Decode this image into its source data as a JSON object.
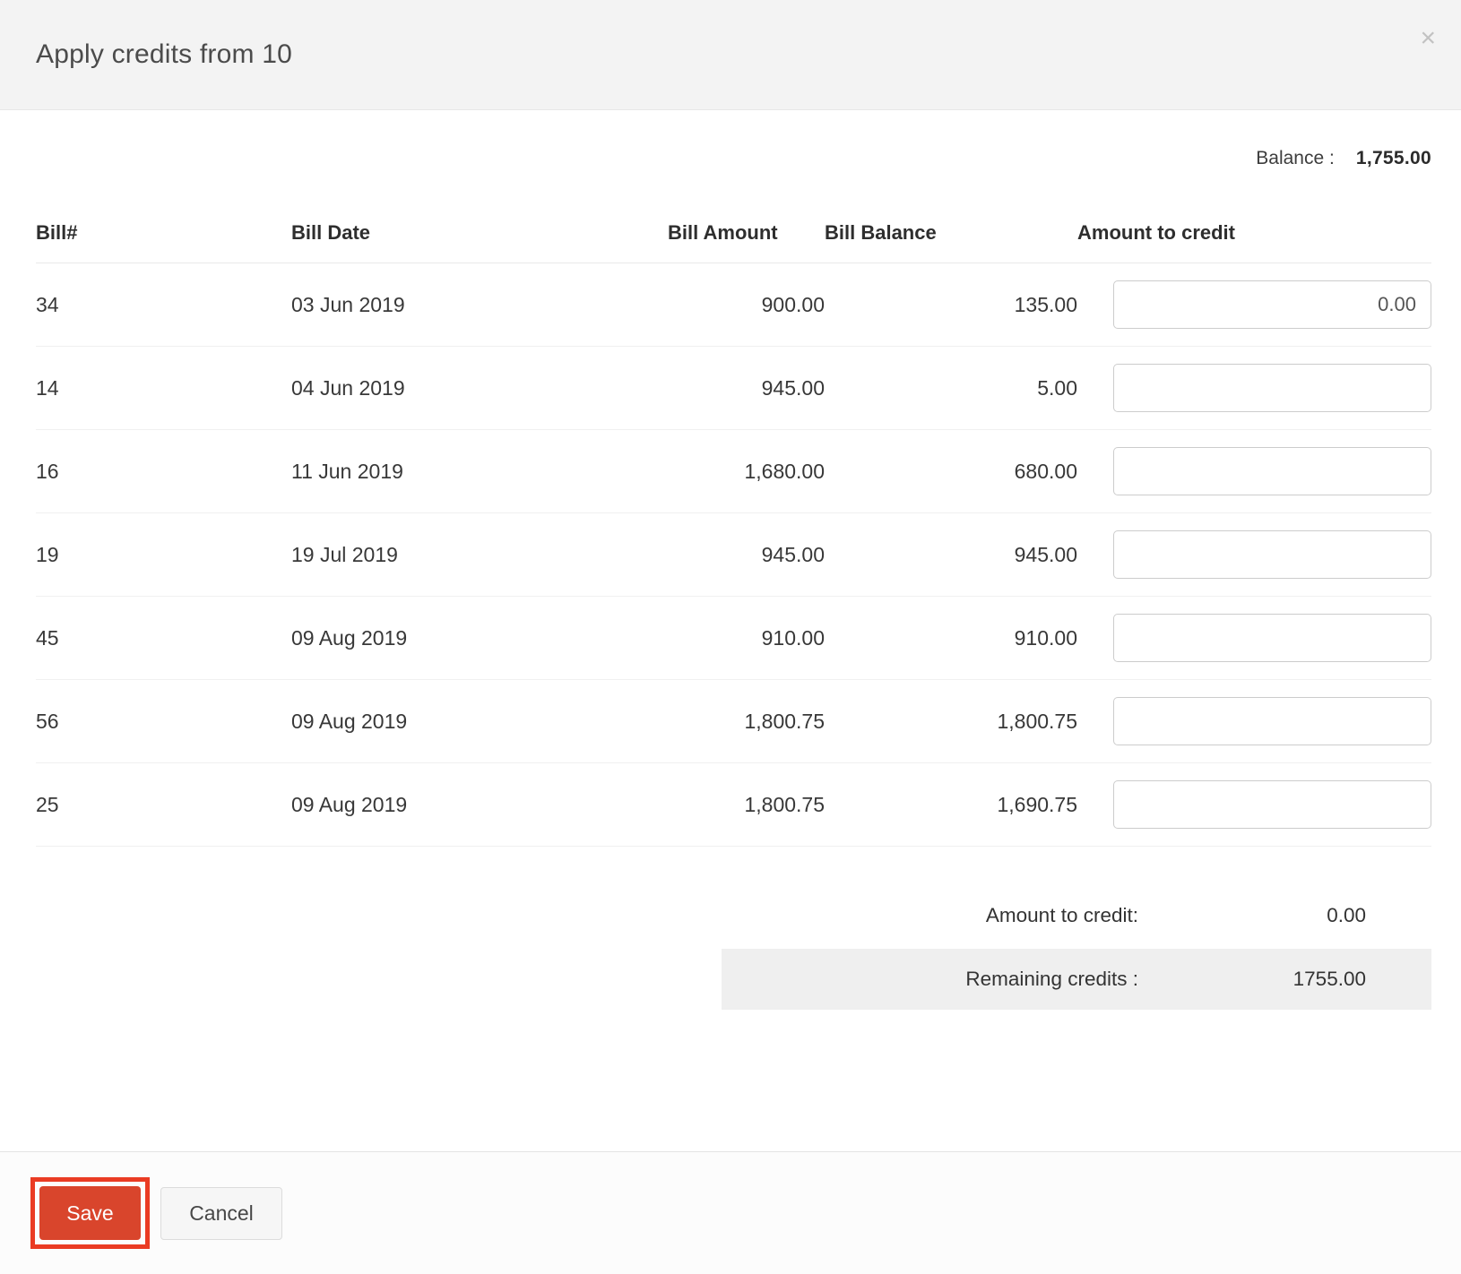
{
  "modal": {
    "title": "Apply credits from 10"
  },
  "icons": {
    "close": "×"
  },
  "balance": {
    "label": "Balance :",
    "value": "1,755.00"
  },
  "table": {
    "columns": [
      "Bill#",
      "Bill Date",
      "Bill Amount",
      "Bill Balance",
      "Amount to credit"
    ],
    "rows": [
      {
        "bill_no": "34",
        "bill_date": "03 Jun 2019",
        "bill_amount": "900.00",
        "bill_balance": "135.00",
        "amount_to_credit": "0.00"
      },
      {
        "bill_no": "14",
        "bill_date": "04 Jun 2019",
        "bill_amount": "945.00",
        "bill_balance": "5.00",
        "amount_to_credit": ""
      },
      {
        "bill_no": "16",
        "bill_date": "11 Jun 2019",
        "bill_amount": "1,680.00",
        "bill_balance": "680.00",
        "amount_to_credit": ""
      },
      {
        "bill_no": "19",
        "bill_date": "19 Jul 2019",
        "bill_amount": "945.00",
        "bill_balance": "945.00",
        "amount_to_credit": ""
      },
      {
        "bill_no": "45",
        "bill_date": "09 Aug 2019",
        "bill_amount": "910.00",
        "bill_balance": "910.00",
        "amount_to_credit": ""
      },
      {
        "bill_no": "56",
        "bill_date": "09 Aug 2019",
        "bill_amount": "1,800.75",
        "bill_balance": "1,800.75",
        "amount_to_credit": ""
      },
      {
        "bill_no": "25",
        "bill_date": "09 Aug 2019",
        "bill_amount": "1,800.75",
        "bill_balance": "1,690.75",
        "amount_to_credit": ""
      }
    ]
  },
  "summary": {
    "amount_to_credit_label": "Amount to credit:",
    "amount_to_credit_value": "0.00",
    "remaining_credits_label": "Remaining credits :",
    "remaining_credits_value": "1755.00"
  },
  "footer": {
    "save_label": "Save",
    "cancel_label": "Cancel"
  },
  "colors": {
    "save_button": "#d9452c",
    "save_highlight": "#ea3b23",
    "header_bg": "#f3f3f3",
    "remaining_band_bg": "#efefef"
  }
}
